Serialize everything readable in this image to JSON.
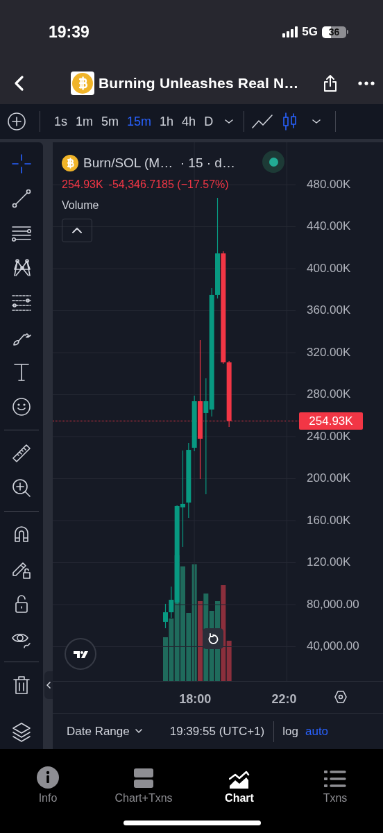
{
  "status_bar": {
    "time": "19:39",
    "network": "5G",
    "battery": "36"
  },
  "header": {
    "title": "Burning Unleashes Real N…"
  },
  "toolbar": {
    "intervals": [
      {
        "label": "1s",
        "selected": false
      },
      {
        "label": "1m",
        "selected": false
      },
      {
        "label": "5m",
        "selected": false
      },
      {
        "label": "15m",
        "selected": true
      },
      {
        "label": "1h",
        "selected": false
      },
      {
        "label": "4h",
        "selected": false
      },
      {
        "label": "D",
        "selected": false
      }
    ],
    "chart_types": [
      {
        "kind": "line",
        "selected": false
      },
      {
        "kind": "candles",
        "selected": true
      }
    ]
  },
  "legend": {
    "symbol": "Burn/SOL (M…  · 15 · d…",
    "live": true,
    "price": "254.93K",
    "change": "-54,346.7185 (−17.57%)",
    "indicator": "Volume"
  },
  "chart_data": {
    "type": "candlestick",
    "categories": [
      null,
      null,
      null,
      null,
      null,
      null,
      null,
      null,
      null,
      null,
      null,
      null,
      null,
      null,
      null,
      null,
      null,
      null,
      null,
      null,
      null,
      null,
      null,
      null,
      "18:00",
      null,
      null,
      null,
      null,
      null,
      null,
      null,
      null,
      null,
      null,
      null,
      null,
      null,
      null,
      null,
      "22:0",
      null
    ],
    "ohlc": [
      null,
      null,
      null,
      null,
      null,
      null,
      null,
      null,
      null,
      null,
      null,
      null,
      null,
      null,
      null,
      null,
      null,
      null,
      null,
      [
        63500,
        80700,
        57500,
        72700
      ],
      [
        72700,
        97200,
        67400,
        84600
      ],
      [
        82000,
        174500,
        80700,
        173900
      ],
      [
        172600,
        226800,
        134900,
        175900
      ],
      [
        177200,
        234000,
        162600,
        227400
      ],
      [
        229400,
        279000,
        226100,
        273700
      ],
      [
        273700,
        331900,
        199700,
        238000
      ],
      [
        262500,
        295500,
        185100,
        273700
      ],
      [
        265800,
        381500,
        259200,
        374900
      ],
      [
        374900,
        467400,
        371600,
        414500
      ],
      [
        414500,
        416500,
        309400,
        310700
      ],
      [
        310700,
        312100,
        249300,
        254930
      ],
      null,
      null,
      null,
      null,
      null,
      null,
      null,
      null,
      null,
      null,
      null
    ],
    "yticks": [
      {
        "value": 480000,
        "label": "480.00K"
      },
      {
        "value": 440000,
        "label": "440.00K"
      },
      {
        "value": 400000,
        "label": "400.00K"
      },
      {
        "value": 360000,
        "label": "360.00K"
      },
      {
        "value": 320000,
        "label": "320.00K"
      },
      {
        "value": 280000,
        "label": "280.00K"
      },
      {
        "value": 240000,
        "label": "240.00K"
      },
      {
        "value": 200000,
        "label": "200.00K"
      },
      {
        "value": 160000,
        "label": "160.00K"
      },
      {
        "value": 120000,
        "label": "120.00K"
      },
      {
        "value": 80000,
        "label": "80,000.00"
      },
      {
        "value": 40000,
        "label": "40,000.00"
      }
    ],
    "ylim": [
      6600,
      520300
    ],
    "grid": true
  },
  "last_price": "254.93K",
  "bottom_bar": {
    "date_range": "Date Range",
    "time": "19:39:55 (UTC+1)",
    "scales": [
      {
        "label": "log",
        "selected": false
      },
      {
        "label": "auto",
        "selected": true
      }
    ]
  },
  "tab_bar": [
    {
      "label": "Info",
      "selected": false
    },
    {
      "label": "Chart+Txns",
      "selected": false
    },
    {
      "label": "Chart",
      "selected": true
    },
    {
      "label": "Txns",
      "selected": false
    }
  ]
}
